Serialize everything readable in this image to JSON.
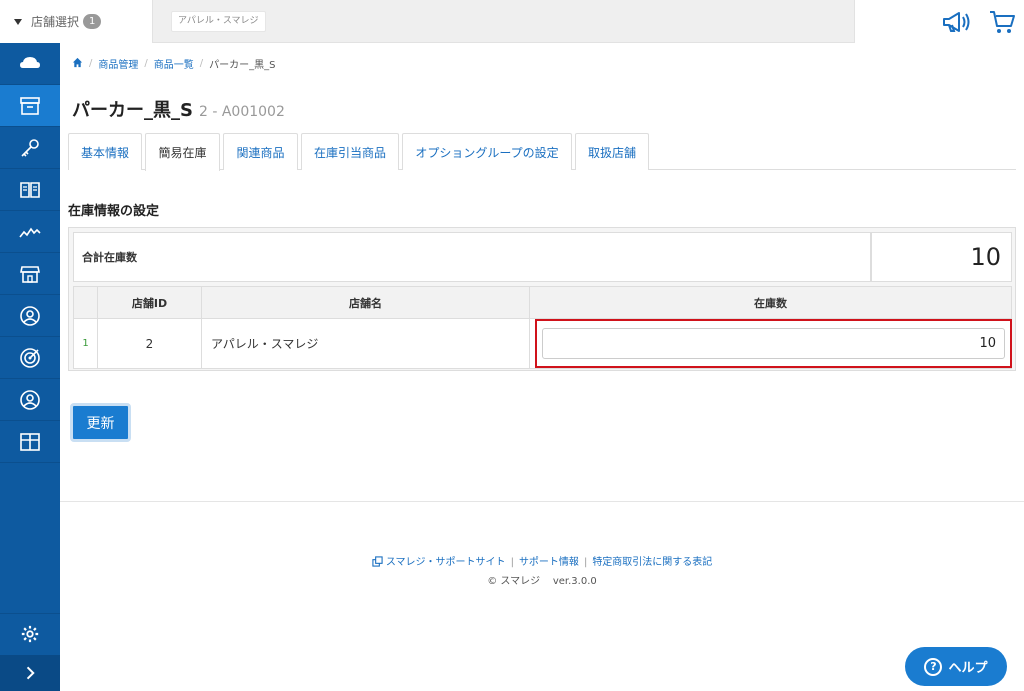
{
  "topbar": {
    "store_select_label": "店舗選択",
    "store_select_count": "1",
    "store_chip": "アパレル・スマレジ"
  },
  "breadcrumb": {
    "items": [
      "商品管理",
      "商品一覧"
    ],
    "current": "パーカー_黒_S"
  },
  "product": {
    "name": "パーカー_黒_S",
    "code": "2 - A001002"
  },
  "tabs": [
    {
      "label": "基本情報"
    },
    {
      "label": "簡易在庫"
    },
    {
      "label": "関連商品"
    },
    {
      "label": "在庫引当商品"
    },
    {
      "label": "オプショングループの設定"
    },
    {
      "label": "取扱店舗"
    }
  ],
  "stock": {
    "section_title": "在庫情報の設定",
    "total_label": "合計在庫数",
    "total_value": "10",
    "columns": [
      "店舗ID",
      "店舗名",
      "在庫数"
    ],
    "rows": [
      {
        "index": "1",
        "store_id": "2",
        "store_name": "アパレル・スマレジ",
        "stock": "10"
      }
    ],
    "update_label": "更新"
  },
  "footer": {
    "support_site": "スマレジ・サポートサイト",
    "support_info": "サポート情報",
    "legal": "特定商取引法に関する表記",
    "copyright": "© スマレジ",
    "version": "ver.3.0.0"
  },
  "help": {
    "label": "ヘルプ"
  },
  "colors": {
    "sidebar": "#0e5aa0",
    "accent": "#1a7cd0",
    "highlight": "#d0121b"
  }
}
